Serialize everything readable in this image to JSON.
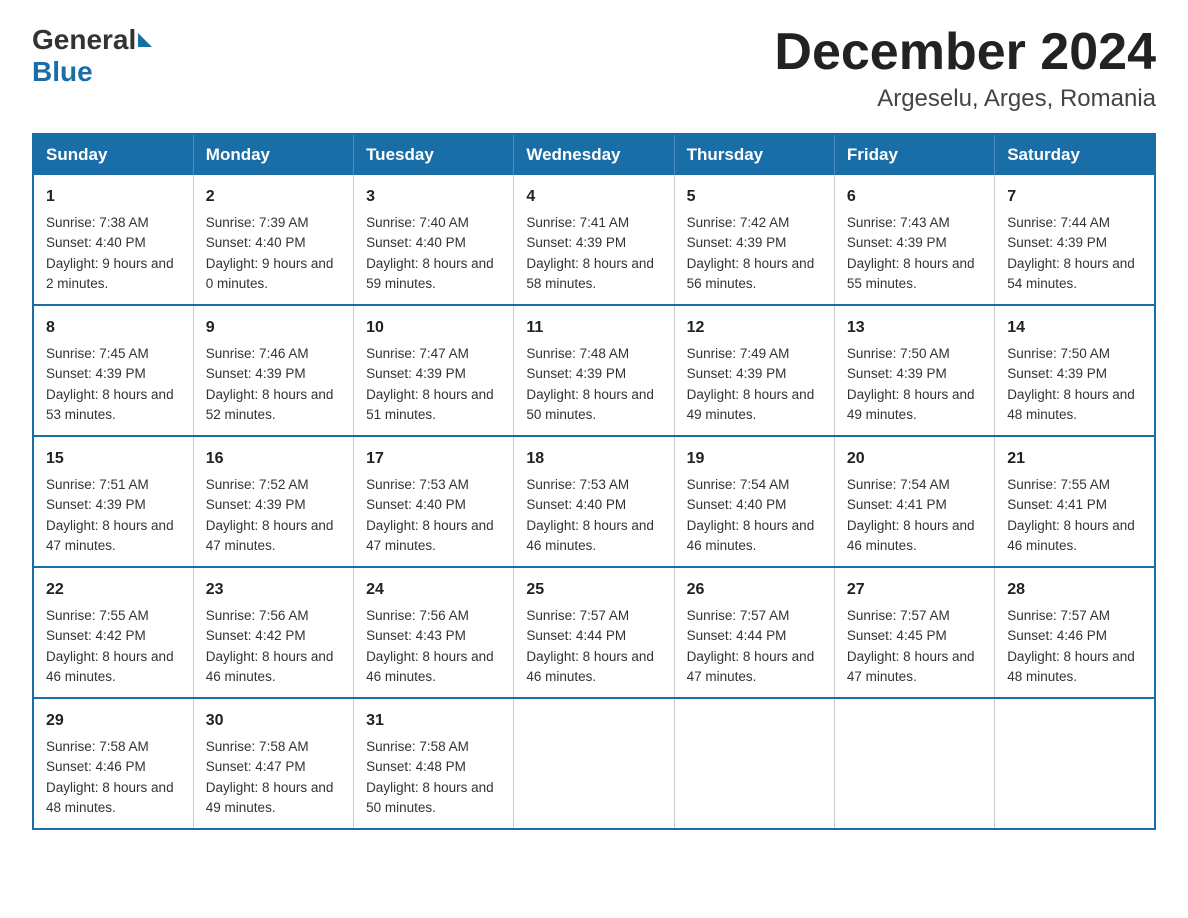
{
  "header": {
    "logo_general": "General",
    "logo_blue": "Blue",
    "month_title": "December 2024",
    "location": "Argeselu, Arges, Romania"
  },
  "days_of_week": [
    "Sunday",
    "Monday",
    "Tuesday",
    "Wednesday",
    "Thursday",
    "Friday",
    "Saturday"
  ],
  "weeks": [
    [
      {
        "day": "1",
        "sunrise": "Sunrise: 7:38 AM",
        "sunset": "Sunset: 4:40 PM",
        "daylight": "Daylight: 9 hours and 2 minutes."
      },
      {
        "day": "2",
        "sunrise": "Sunrise: 7:39 AM",
        "sunset": "Sunset: 4:40 PM",
        "daylight": "Daylight: 9 hours and 0 minutes."
      },
      {
        "day": "3",
        "sunrise": "Sunrise: 7:40 AM",
        "sunset": "Sunset: 4:40 PM",
        "daylight": "Daylight: 8 hours and 59 minutes."
      },
      {
        "day": "4",
        "sunrise": "Sunrise: 7:41 AM",
        "sunset": "Sunset: 4:39 PM",
        "daylight": "Daylight: 8 hours and 58 minutes."
      },
      {
        "day": "5",
        "sunrise": "Sunrise: 7:42 AM",
        "sunset": "Sunset: 4:39 PM",
        "daylight": "Daylight: 8 hours and 56 minutes."
      },
      {
        "day": "6",
        "sunrise": "Sunrise: 7:43 AM",
        "sunset": "Sunset: 4:39 PM",
        "daylight": "Daylight: 8 hours and 55 minutes."
      },
      {
        "day": "7",
        "sunrise": "Sunrise: 7:44 AM",
        "sunset": "Sunset: 4:39 PM",
        "daylight": "Daylight: 8 hours and 54 minutes."
      }
    ],
    [
      {
        "day": "8",
        "sunrise": "Sunrise: 7:45 AM",
        "sunset": "Sunset: 4:39 PM",
        "daylight": "Daylight: 8 hours and 53 minutes."
      },
      {
        "day": "9",
        "sunrise": "Sunrise: 7:46 AM",
        "sunset": "Sunset: 4:39 PM",
        "daylight": "Daylight: 8 hours and 52 minutes."
      },
      {
        "day": "10",
        "sunrise": "Sunrise: 7:47 AM",
        "sunset": "Sunset: 4:39 PM",
        "daylight": "Daylight: 8 hours and 51 minutes."
      },
      {
        "day": "11",
        "sunrise": "Sunrise: 7:48 AM",
        "sunset": "Sunset: 4:39 PM",
        "daylight": "Daylight: 8 hours and 50 minutes."
      },
      {
        "day": "12",
        "sunrise": "Sunrise: 7:49 AM",
        "sunset": "Sunset: 4:39 PM",
        "daylight": "Daylight: 8 hours and 49 minutes."
      },
      {
        "day": "13",
        "sunrise": "Sunrise: 7:50 AM",
        "sunset": "Sunset: 4:39 PM",
        "daylight": "Daylight: 8 hours and 49 minutes."
      },
      {
        "day": "14",
        "sunrise": "Sunrise: 7:50 AM",
        "sunset": "Sunset: 4:39 PM",
        "daylight": "Daylight: 8 hours and 48 minutes."
      }
    ],
    [
      {
        "day": "15",
        "sunrise": "Sunrise: 7:51 AM",
        "sunset": "Sunset: 4:39 PM",
        "daylight": "Daylight: 8 hours and 47 minutes."
      },
      {
        "day": "16",
        "sunrise": "Sunrise: 7:52 AM",
        "sunset": "Sunset: 4:39 PM",
        "daylight": "Daylight: 8 hours and 47 minutes."
      },
      {
        "day": "17",
        "sunrise": "Sunrise: 7:53 AM",
        "sunset": "Sunset: 4:40 PM",
        "daylight": "Daylight: 8 hours and 47 minutes."
      },
      {
        "day": "18",
        "sunrise": "Sunrise: 7:53 AM",
        "sunset": "Sunset: 4:40 PM",
        "daylight": "Daylight: 8 hours and 46 minutes."
      },
      {
        "day": "19",
        "sunrise": "Sunrise: 7:54 AM",
        "sunset": "Sunset: 4:40 PM",
        "daylight": "Daylight: 8 hours and 46 minutes."
      },
      {
        "day": "20",
        "sunrise": "Sunrise: 7:54 AM",
        "sunset": "Sunset: 4:41 PM",
        "daylight": "Daylight: 8 hours and 46 minutes."
      },
      {
        "day": "21",
        "sunrise": "Sunrise: 7:55 AM",
        "sunset": "Sunset: 4:41 PM",
        "daylight": "Daylight: 8 hours and 46 minutes."
      }
    ],
    [
      {
        "day": "22",
        "sunrise": "Sunrise: 7:55 AM",
        "sunset": "Sunset: 4:42 PM",
        "daylight": "Daylight: 8 hours and 46 minutes."
      },
      {
        "day": "23",
        "sunrise": "Sunrise: 7:56 AM",
        "sunset": "Sunset: 4:42 PM",
        "daylight": "Daylight: 8 hours and 46 minutes."
      },
      {
        "day": "24",
        "sunrise": "Sunrise: 7:56 AM",
        "sunset": "Sunset: 4:43 PM",
        "daylight": "Daylight: 8 hours and 46 minutes."
      },
      {
        "day": "25",
        "sunrise": "Sunrise: 7:57 AM",
        "sunset": "Sunset: 4:44 PM",
        "daylight": "Daylight: 8 hours and 46 minutes."
      },
      {
        "day": "26",
        "sunrise": "Sunrise: 7:57 AM",
        "sunset": "Sunset: 4:44 PM",
        "daylight": "Daylight: 8 hours and 47 minutes."
      },
      {
        "day": "27",
        "sunrise": "Sunrise: 7:57 AM",
        "sunset": "Sunset: 4:45 PM",
        "daylight": "Daylight: 8 hours and 47 minutes."
      },
      {
        "day": "28",
        "sunrise": "Sunrise: 7:57 AM",
        "sunset": "Sunset: 4:46 PM",
        "daylight": "Daylight: 8 hours and 48 minutes."
      }
    ],
    [
      {
        "day": "29",
        "sunrise": "Sunrise: 7:58 AM",
        "sunset": "Sunset: 4:46 PM",
        "daylight": "Daylight: 8 hours and 48 minutes."
      },
      {
        "day": "30",
        "sunrise": "Sunrise: 7:58 AM",
        "sunset": "Sunset: 4:47 PM",
        "daylight": "Daylight: 8 hours and 49 minutes."
      },
      {
        "day": "31",
        "sunrise": "Sunrise: 7:58 AM",
        "sunset": "Sunset: 4:48 PM",
        "daylight": "Daylight: 8 hours and 50 minutes."
      },
      null,
      null,
      null,
      null
    ]
  ]
}
